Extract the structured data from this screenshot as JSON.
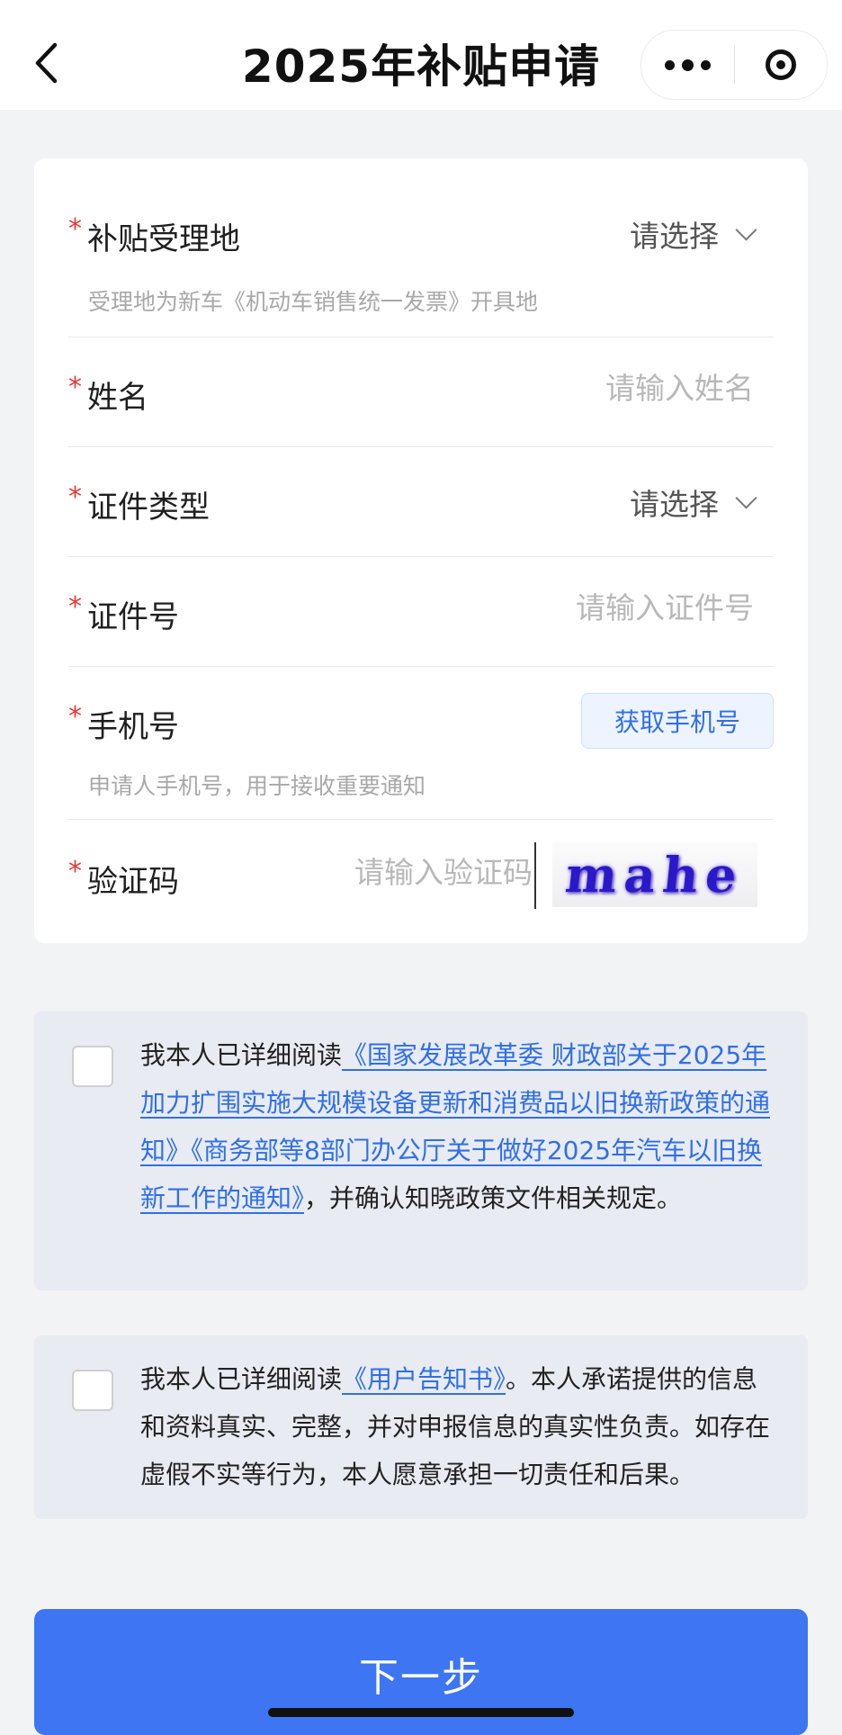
{
  "navbar": {
    "back_icon": "chevron-left-icon",
    "title": "2025年补贴申请",
    "more_icon": "more-dots-icon",
    "close_icon": "target-circle-icon"
  },
  "form": {
    "location": {
      "required": "*",
      "label": "补贴受理地",
      "value": "请选择",
      "hint": "受理地为新车《机动车销售统一发票》开具地"
    },
    "name": {
      "required": "*",
      "label": "姓名",
      "placeholder": "请输入姓名"
    },
    "id_type": {
      "required": "*",
      "label": "证件类型",
      "value": "请选择"
    },
    "id_number": {
      "required": "*",
      "label": "证件号",
      "placeholder": "请输入证件号"
    },
    "phone": {
      "required": "*",
      "label": "手机号",
      "button": "获取手机号",
      "hint": "申请人手机号，用于接收重要通知"
    },
    "captcha": {
      "required": "*",
      "label": "验证码",
      "placeholder": "请输入验证码",
      "image_text": "mahe"
    }
  },
  "agreements": [
    {
      "prefix": "我本人已详细阅读",
      "link1": "《国家发展改革委 财政部关于2025年加力扩围实施大规模设备更新和消费品以旧换新政策的通知》",
      "link2": "《商务部等8部门办公厅关于做好2025年汽车以旧换新工作的通知》",
      "suffix": "，并确认知晓政策文件相关规定。"
    },
    {
      "prefix": "我本人已详细阅读",
      "link1": "《用户告知书》",
      "suffix": "。本人承诺提供的信息和资料真实、完整，并对申报信息的真实性负责。如存在虚假不实等行为，本人愿意承担一切责任和后果。"
    }
  ],
  "next_button": "下一步",
  "colors": {
    "accent": "#3d75f2",
    "link": "#2f6fe8",
    "required": "#e53935",
    "background": "#f2f3f5"
  }
}
